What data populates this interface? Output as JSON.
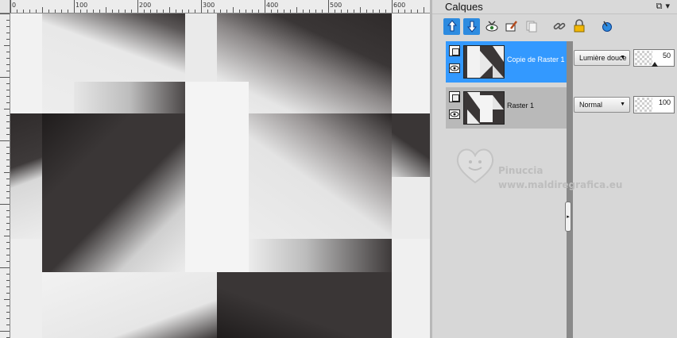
{
  "rulers": {
    "top_labels": [
      "0",
      "100",
      "200",
      "300",
      "400",
      "500",
      "600"
    ],
    "left_labels": [
      "0",
      "100",
      "200",
      "300",
      "400"
    ]
  },
  "layers_panel": {
    "title": "Calques",
    "controls": [
      "pin-icon",
      "menu-arrow-icon"
    ],
    "toolbar": [
      {
        "name": "new-layer-up-icon",
        "color": "#1e5fd6"
      },
      {
        "name": "new-layer-down-icon",
        "color": "#1e5fd6"
      },
      {
        "name": "eye-visibility-icon",
        "color": "#2e7d32"
      },
      {
        "name": "brush-layer-icon",
        "color": "#b34b1e"
      },
      {
        "name": "copy-layer-icon",
        "color": "#9e9e9e"
      },
      {
        "name": "link-icon",
        "color": "#555555"
      },
      {
        "name": "lock-icon",
        "color": "#e0a800"
      },
      {
        "name": "properties-icon",
        "color": "#1e5fd6"
      }
    ],
    "layers": [
      {
        "name": "Copie de Raster 1",
        "blend_mode": "Lumière douce",
        "opacity": "50",
        "selected": true
      },
      {
        "name": "Raster 1",
        "blend_mode": "Normal",
        "opacity": "100",
        "selected": false
      }
    ]
  },
  "watermark": {
    "name": "Pinuccia",
    "url": "www.maldiregrafica.eu"
  },
  "colors": {
    "selected": "#3399ff",
    "dark": "#3a3636",
    "light": "#efefef"
  }
}
